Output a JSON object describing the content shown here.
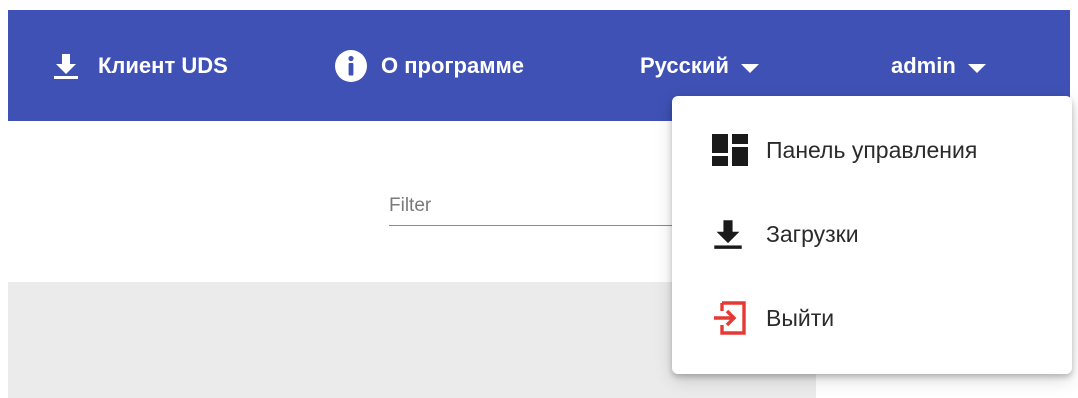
{
  "topbar": {
    "background": "#3f51b5",
    "client": {
      "label": "Клиент UDS",
      "icon": "download-icon"
    },
    "about": {
      "label": "О программе",
      "icon": "info-icon"
    },
    "language": {
      "label": "Русский",
      "icon": "chevron-down-icon"
    },
    "user": {
      "label": "admin",
      "icon": "chevron-down-icon"
    }
  },
  "filter": {
    "placeholder": "Filter",
    "value": ""
  },
  "user_menu": {
    "items": [
      {
        "label": "Панель управления",
        "icon": "dashboard-icon"
      },
      {
        "label": "Загрузки",
        "icon": "download-icon"
      },
      {
        "label": "Выйти",
        "icon": "exit-icon",
        "icon_color": "#e53935"
      }
    ]
  }
}
